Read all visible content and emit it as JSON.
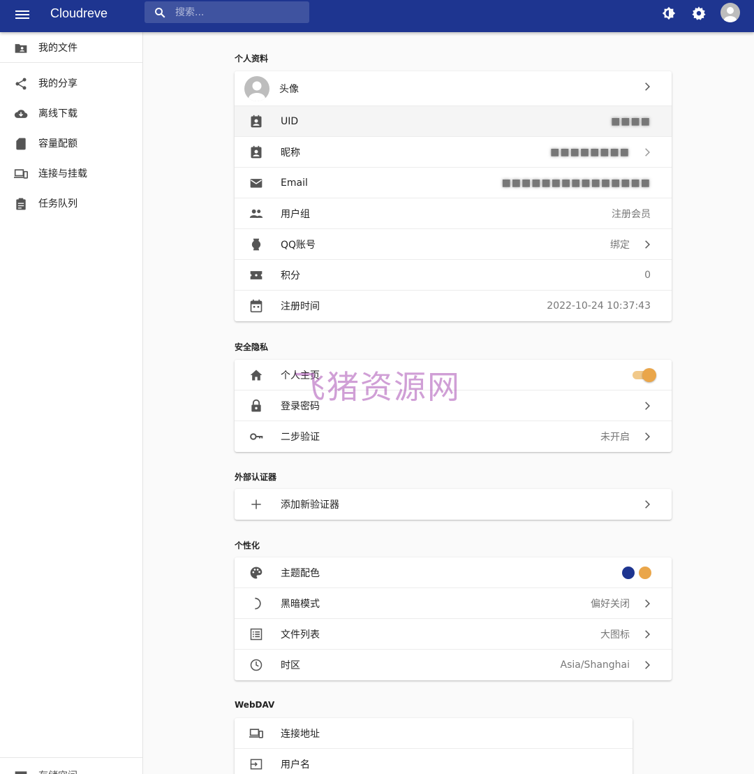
{
  "app": {
    "title": "Cloudreve",
    "search_placeholder": "搜索..."
  },
  "sidebar": {
    "items": [
      {
        "label": "我的文件"
      },
      {
        "label": "我的分享"
      },
      {
        "label": "离线下载"
      },
      {
        "label": "容量配额"
      },
      {
        "label": "连接与挂载"
      },
      {
        "label": "任务队列"
      }
    ],
    "bottom_label": "存储空间"
  },
  "sections": {
    "profile": {
      "title": "个人资料",
      "avatar_label": "头像",
      "uid_label": "UID",
      "uid_value": "■■■■",
      "nickname_label": "昵称",
      "nickname_value": "■■■■■■■■",
      "email_label": "Email",
      "email_value": "■■■■■■■■■■■■■■■",
      "group_label": "用户组",
      "group_value": "注册会员",
      "qq_label": "QQ账号",
      "qq_value": "绑定",
      "points_label": "积分",
      "points_value": "0",
      "register_label": "注册时间",
      "register_value": "2022-10-24 10:37:43"
    },
    "security": {
      "title": "安全隐私",
      "homepage_label": "个人主页",
      "homepage_enabled": true,
      "password_label": "登录密码",
      "twofa_label": "二步验证",
      "twofa_value": "未开启"
    },
    "authenticator": {
      "title": "外部认证器",
      "add_label": "添加新验证器"
    },
    "personalize": {
      "title": "个性化",
      "theme_label": "主题配色",
      "theme_colors": [
        "#1e3590",
        "#eaa64a"
      ],
      "dark_label": "黑暗模式",
      "dark_value": "偏好关闭",
      "filelist_label": "文件列表",
      "filelist_value": "大图标",
      "timezone_label": "时区",
      "timezone_value": "Asia/Shanghai"
    },
    "webdav": {
      "title": "WebDAV",
      "address_label": "连接地址",
      "username_label": "用户名"
    }
  },
  "watermark": "飞猪资源网",
  "colors": {
    "primary": "#1e3590",
    "accent": "#eaa64a"
  }
}
